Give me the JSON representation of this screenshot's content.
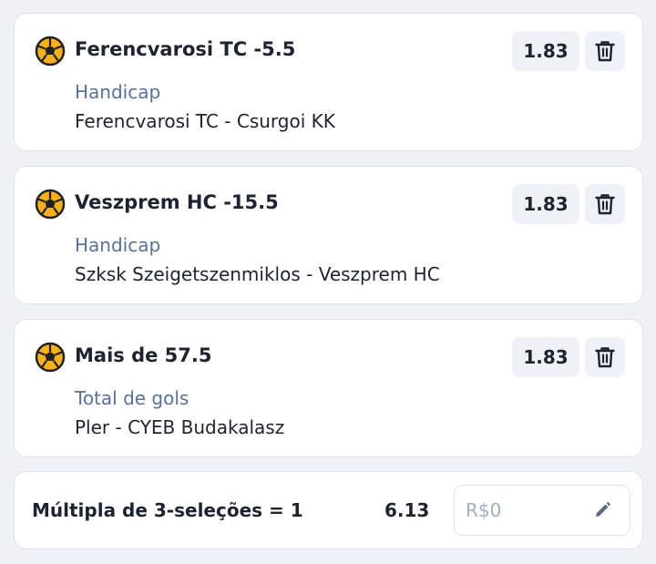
{
  "bets": [
    {
      "title": "Ferencvarosi TC -5.5",
      "market": "Handicap",
      "event": "Ferencvarosi TC - Csurgoi KK",
      "odds": "1.83",
      "sport_icon": "handball-icon",
      "delete_icon": "trash-icon"
    },
    {
      "title": "Veszprem HC -15.5",
      "market": "Handicap",
      "event": "Szksk Szeigetszenmiklos - Veszprem HC",
      "odds": "1.83",
      "sport_icon": "handball-icon",
      "delete_icon": "trash-icon"
    },
    {
      "title": "Mais de 57.5",
      "market": "Total de gols",
      "event": "Pler - CYEB Budakalasz",
      "odds": "1.83",
      "sport_icon": "handball-icon",
      "delete_icon": "trash-icon"
    }
  ],
  "summary": {
    "label": "Múltipla de 3-seleções = 1",
    "total_odds": "6.13",
    "stake_placeholder": "R$0",
    "stake_value": "",
    "edit_icon": "pencil-icon"
  },
  "colors": {
    "background": "#eef1f6",
    "card": "#ffffff",
    "market_text": "#5b7196",
    "ball_fill": "#f5b020",
    "button_bg": "#eef1f5"
  }
}
